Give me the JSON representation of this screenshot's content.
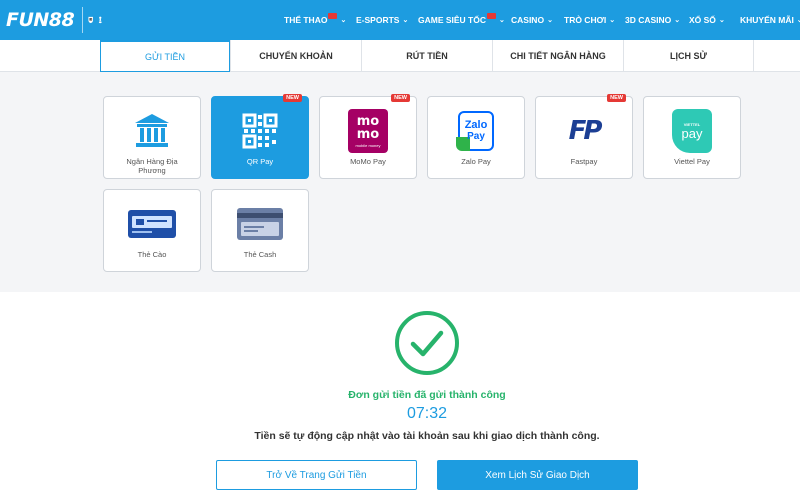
{
  "brand": {
    "logo_text": "FUN88"
  },
  "nav": {
    "items": [
      {
        "label": "THỂ THAO",
        "hot": true
      },
      {
        "label": "E-SPORTS",
        "hot": false
      },
      {
        "label": "GAME SIÊU TỐC",
        "hot": true
      },
      {
        "label": "CASINO",
        "hot": false
      },
      {
        "label": "TRÒ CHƠI",
        "hot": false
      },
      {
        "label": "3D CASINO",
        "hot": false
      },
      {
        "label": "XỔ SỐ",
        "hot": false
      },
      {
        "label": "KHUYẾN MÃI",
        "hot": false
      }
    ]
  },
  "tabs": [
    {
      "label": "GỬI TIỀN",
      "active": true
    },
    {
      "label": "CHUYỂN KHOẢN",
      "active": false
    },
    {
      "label": "RÚT TIỀN",
      "active": false
    },
    {
      "label": "CHI TIẾT NGÂN HÀNG",
      "active": false
    },
    {
      "label": "LỊCH SỬ",
      "active": false
    }
  ],
  "methods": [
    {
      "label": "Ngân Hàng Địa Phương",
      "icon": "bank-icon",
      "new": false,
      "selected": false
    },
    {
      "label": "QR Pay",
      "icon": "qr-code-icon",
      "new": true,
      "selected": true
    },
    {
      "label": "MoMo Pay",
      "icon": "momo-logo-icon",
      "new": true,
      "selected": false,
      "logo_text": "mo mo",
      "logo_sub": "mobile money"
    },
    {
      "label": "Zalo Pay",
      "icon": "zalo-pay-logo-icon",
      "new": false,
      "selected": false,
      "logo_text": "Zalo",
      "logo_sub": "Pay"
    },
    {
      "label": "Fastpay",
      "icon": "fastpay-logo-icon",
      "new": true,
      "selected": false,
      "logo_text": "FP"
    },
    {
      "label": "Viettel Pay",
      "icon": "viettel-pay-logo-icon",
      "new": false,
      "selected": false,
      "logo_text": "pay",
      "logo_sub": "VIETTEL"
    },
    {
      "label": "Thẻ Cào",
      "icon": "scratch-card-icon",
      "new": false,
      "selected": false
    },
    {
      "label": "Thẻ Cash",
      "icon": "cash-card-icon",
      "new": false,
      "selected": false
    }
  ],
  "new_badge": "NEW",
  "result": {
    "message": "Đơn gửi tiền đã gửi thành công",
    "timer": "07:32",
    "note": "Tiền sẽ tự động cập nhật vào tài khoản sau khi giao dịch thành công.",
    "back_button": "Trở Về Trang Gửi Tiền",
    "history_button": "Xem Lịch Sử Giao Dịch"
  },
  "colors": {
    "primary": "#1d9ce0",
    "success": "#27b36b",
    "hot": "#e53935",
    "momo": "#a50064",
    "zalo": "#0068ff",
    "viettel": "#2ec9b5"
  }
}
